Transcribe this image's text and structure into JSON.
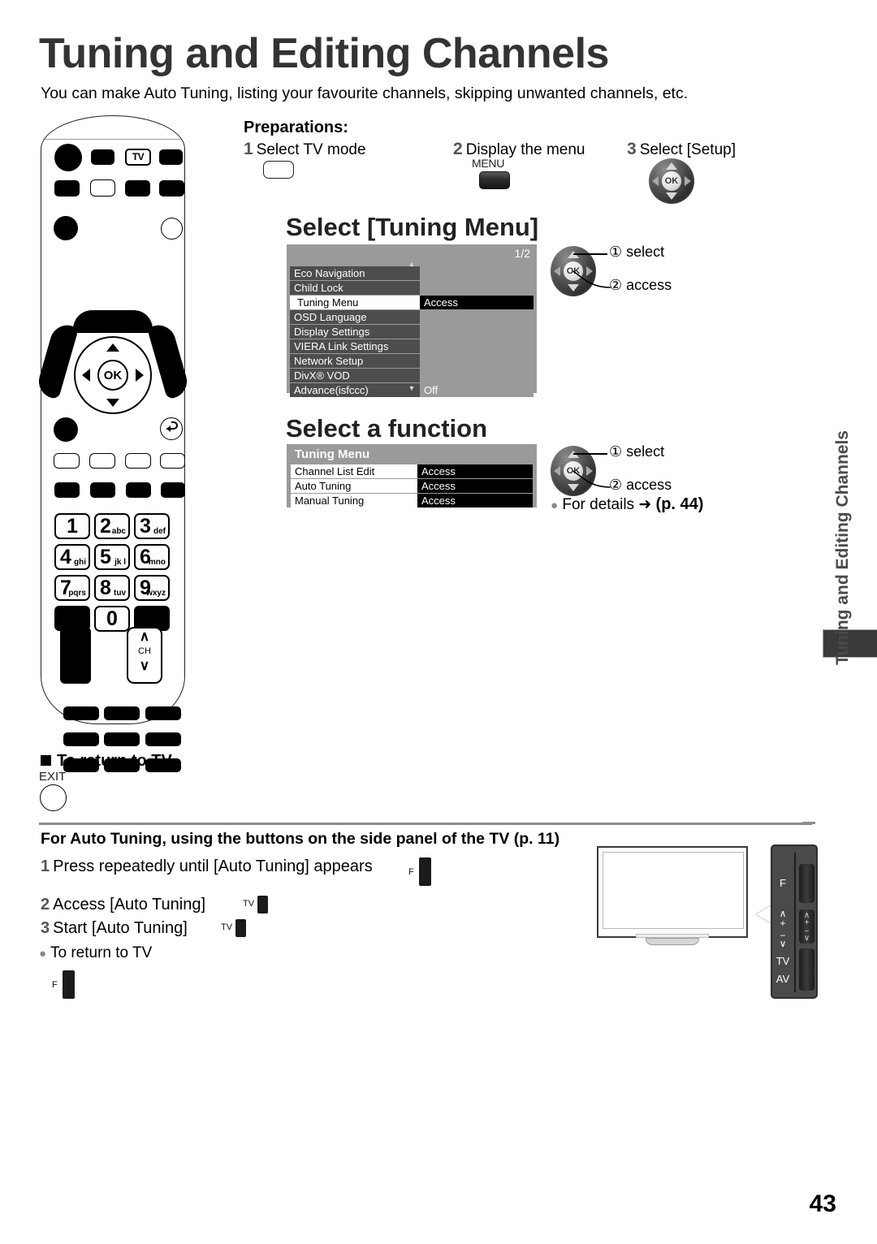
{
  "header": {
    "title": "Tuning and Editing Channels",
    "subtitle": "You can make Auto Tuning, listing your favourite channels, skipping unwanted channels, etc."
  },
  "preparations": {
    "heading": "Preparations:",
    "steps": [
      {
        "num": "1",
        "text": "Select TV mode",
        "icon": "tv-mode-button"
      },
      {
        "num": "2",
        "text": "Display the menu",
        "icon": "menu-button",
        "caption": "MENU"
      },
      {
        "num": "3",
        "text": "Select [Setup]",
        "icon": "cursor-ok-pad",
        "ok_label": "OK"
      }
    ]
  },
  "section_select_tuning_menu": {
    "heading": "Select [Tuning Menu]",
    "osd": {
      "page_indicator": "1/2",
      "rows": [
        {
          "label": "Eco Navigation",
          "value": "",
          "selected": false
        },
        {
          "label": "Child Lock",
          "value": "",
          "selected": false
        },
        {
          "label": "Tuning Menu",
          "value": "Access",
          "selected": true
        },
        {
          "label": "OSD Language",
          "value": "",
          "selected": false
        },
        {
          "label": "Display Settings",
          "value": "",
          "selected": false
        },
        {
          "label": "VIERA Link Settings",
          "value": "",
          "selected": false
        },
        {
          "label": "Network Setup",
          "value": "",
          "selected": false
        },
        {
          "label": "DivX® VOD",
          "value": "",
          "selected": false
        },
        {
          "label": "Advance(isfccc)",
          "value": "Off",
          "selected": false
        }
      ]
    },
    "callouts": {
      "select": "① select",
      "access": "② access"
    },
    "ok_label": "OK"
  },
  "section_select_a_function": {
    "heading": "Select a function",
    "osd": {
      "title": "Tuning Menu",
      "rows": [
        {
          "label": "Channel List Edit",
          "value": "Access"
        },
        {
          "label": "Auto Tuning",
          "value": "Access"
        },
        {
          "label": "Manual Tuning",
          "value": "Access"
        }
      ]
    },
    "callouts": {
      "select": "① select",
      "access": "② access"
    },
    "ok_label": "OK",
    "details": {
      "bullet": "●",
      "text": "For details",
      "arrow": "➜",
      "page_ref": "(p. 44)"
    }
  },
  "return_to_tv": {
    "heading": "To return to TV",
    "button_label": "EXIT"
  },
  "side_panel_section": {
    "heading": "For Auto Tuning, using the buttons on the side panel of the TV (p. 11)",
    "steps": [
      {
        "num": "1",
        "text": "Press repeatedly until [Auto Tuning] appears",
        "button": "F"
      },
      {
        "num": "2",
        "text": "Access [Auto Tuning]",
        "button": "TV"
      },
      {
        "num": "3",
        "text": "Start [Auto Tuning]",
        "button": "TV"
      }
    ],
    "note": {
      "bullet": "●",
      "text": "To return to TV",
      "button": "F"
    }
  },
  "tv_illustration": {
    "panel_labels": [
      "F",
      "∧\n+",
      "−\n∨",
      "TV",
      "AV"
    ],
    "panel_label_f": "F",
    "panel_label_vol_up": "∧",
    "panel_label_plus": "+",
    "panel_label_minus": "−",
    "panel_label_vol_down": "∨",
    "panel_label_tv": "TV",
    "panel_label_av": "AV"
  },
  "remote": {
    "tv_key_label": "TV",
    "ok_label": "OK",
    "ch_label": "CH",
    "ch_up": "∧",
    "ch_down": "∨",
    "numeric_keys": [
      {
        "digit": "1",
        "letters": ""
      },
      {
        "digit": "2",
        "letters": "abc"
      },
      {
        "digit": "3",
        "letters": "def"
      },
      {
        "digit": "4",
        "letters": "ghi"
      },
      {
        "digit": "5",
        "letters": "jk l"
      },
      {
        "digit": "6",
        "letters": "mno"
      },
      {
        "digit": "7",
        "letters": "pqrs"
      },
      {
        "digit": "8",
        "letters": "tuv"
      },
      {
        "digit": "9",
        "letters": "wxyz"
      },
      {
        "digit": "0",
        "letters": ""
      }
    ]
  },
  "side_tab": {
    "text": "Tuning and Editing Channels"
  },
  "footer": {
    "page_number": "43"
  }
}
